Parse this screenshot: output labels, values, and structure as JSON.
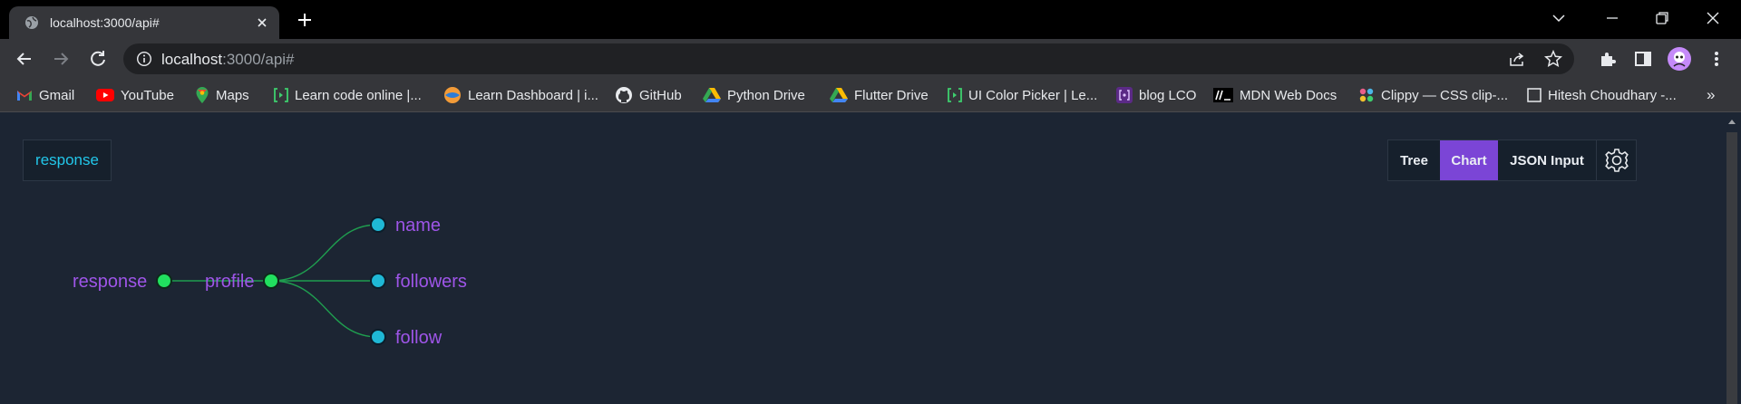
{
  "browser": {
    "tab_title": "localhost:3000/api#",
    "url_host": "localhost",
    "url_path": ":3000/api#"
  },
  "bookmarks": [
    {
      "label": "Gmail",
      "icon": "gmail-icon"
    },
    {
      "label": "YouTube",
      "icon": "youtube-icon"
    },
    {
      "label": "Maps",
      "icon": "maps-icon"
    },
    {
      "label": "Learn code online |...",
      "icon": "learncodeonline-icon"
    },
    {
      "label": "Learn Dashboard | i...",
      "icon": "ineuron-icon"
    },
    {
      "label": "GitHub",
      "icon": "github-icon"
    },
    {
      "label": "Python Drive",
      "icon": "drive-icon"
    },
    {
      "label": "Flutter Drive",
      "icon": "drive-icon"
    },
    {
      "label": "UI Color Picker | Le...",
      "icon": "learncodeonline-icon"
    },
    {
      "label": "blog LCO",
      "icon": "lco-blog-icon"
    },
    {
      "label": "MDN Web Docs",
      "icon": "mdn-icon"
    },
    {
      "label": "Clippy — CSS clip-...",
      "icon": "clippy-icon"
    },
    {
      "label": "Hitesh Choudhary -...",
      "icon": "page-icon"
    }
  ],
  "app": {
    "root_badge": "response",
    "view_buttons": [
      "Tree",
      "Chart",
      "JSON Input"
    ],
    "active_view": "Chart"
  },
  "tree": {
    "root": "response",
    "child": "profile",
    "leaves": [
      "name",
      "followers",
      "follow"
    ]
  },
  "colors": {
    "accent": "#7b45d6",
    "node_label": "#9e55e8",
    "branch_node": "#21e05f",
    "leaf_node": "#1fb8d6",
    "edge": "#1f9d4f",
    "root_badge_text": "#22c7ea"
  }
}
